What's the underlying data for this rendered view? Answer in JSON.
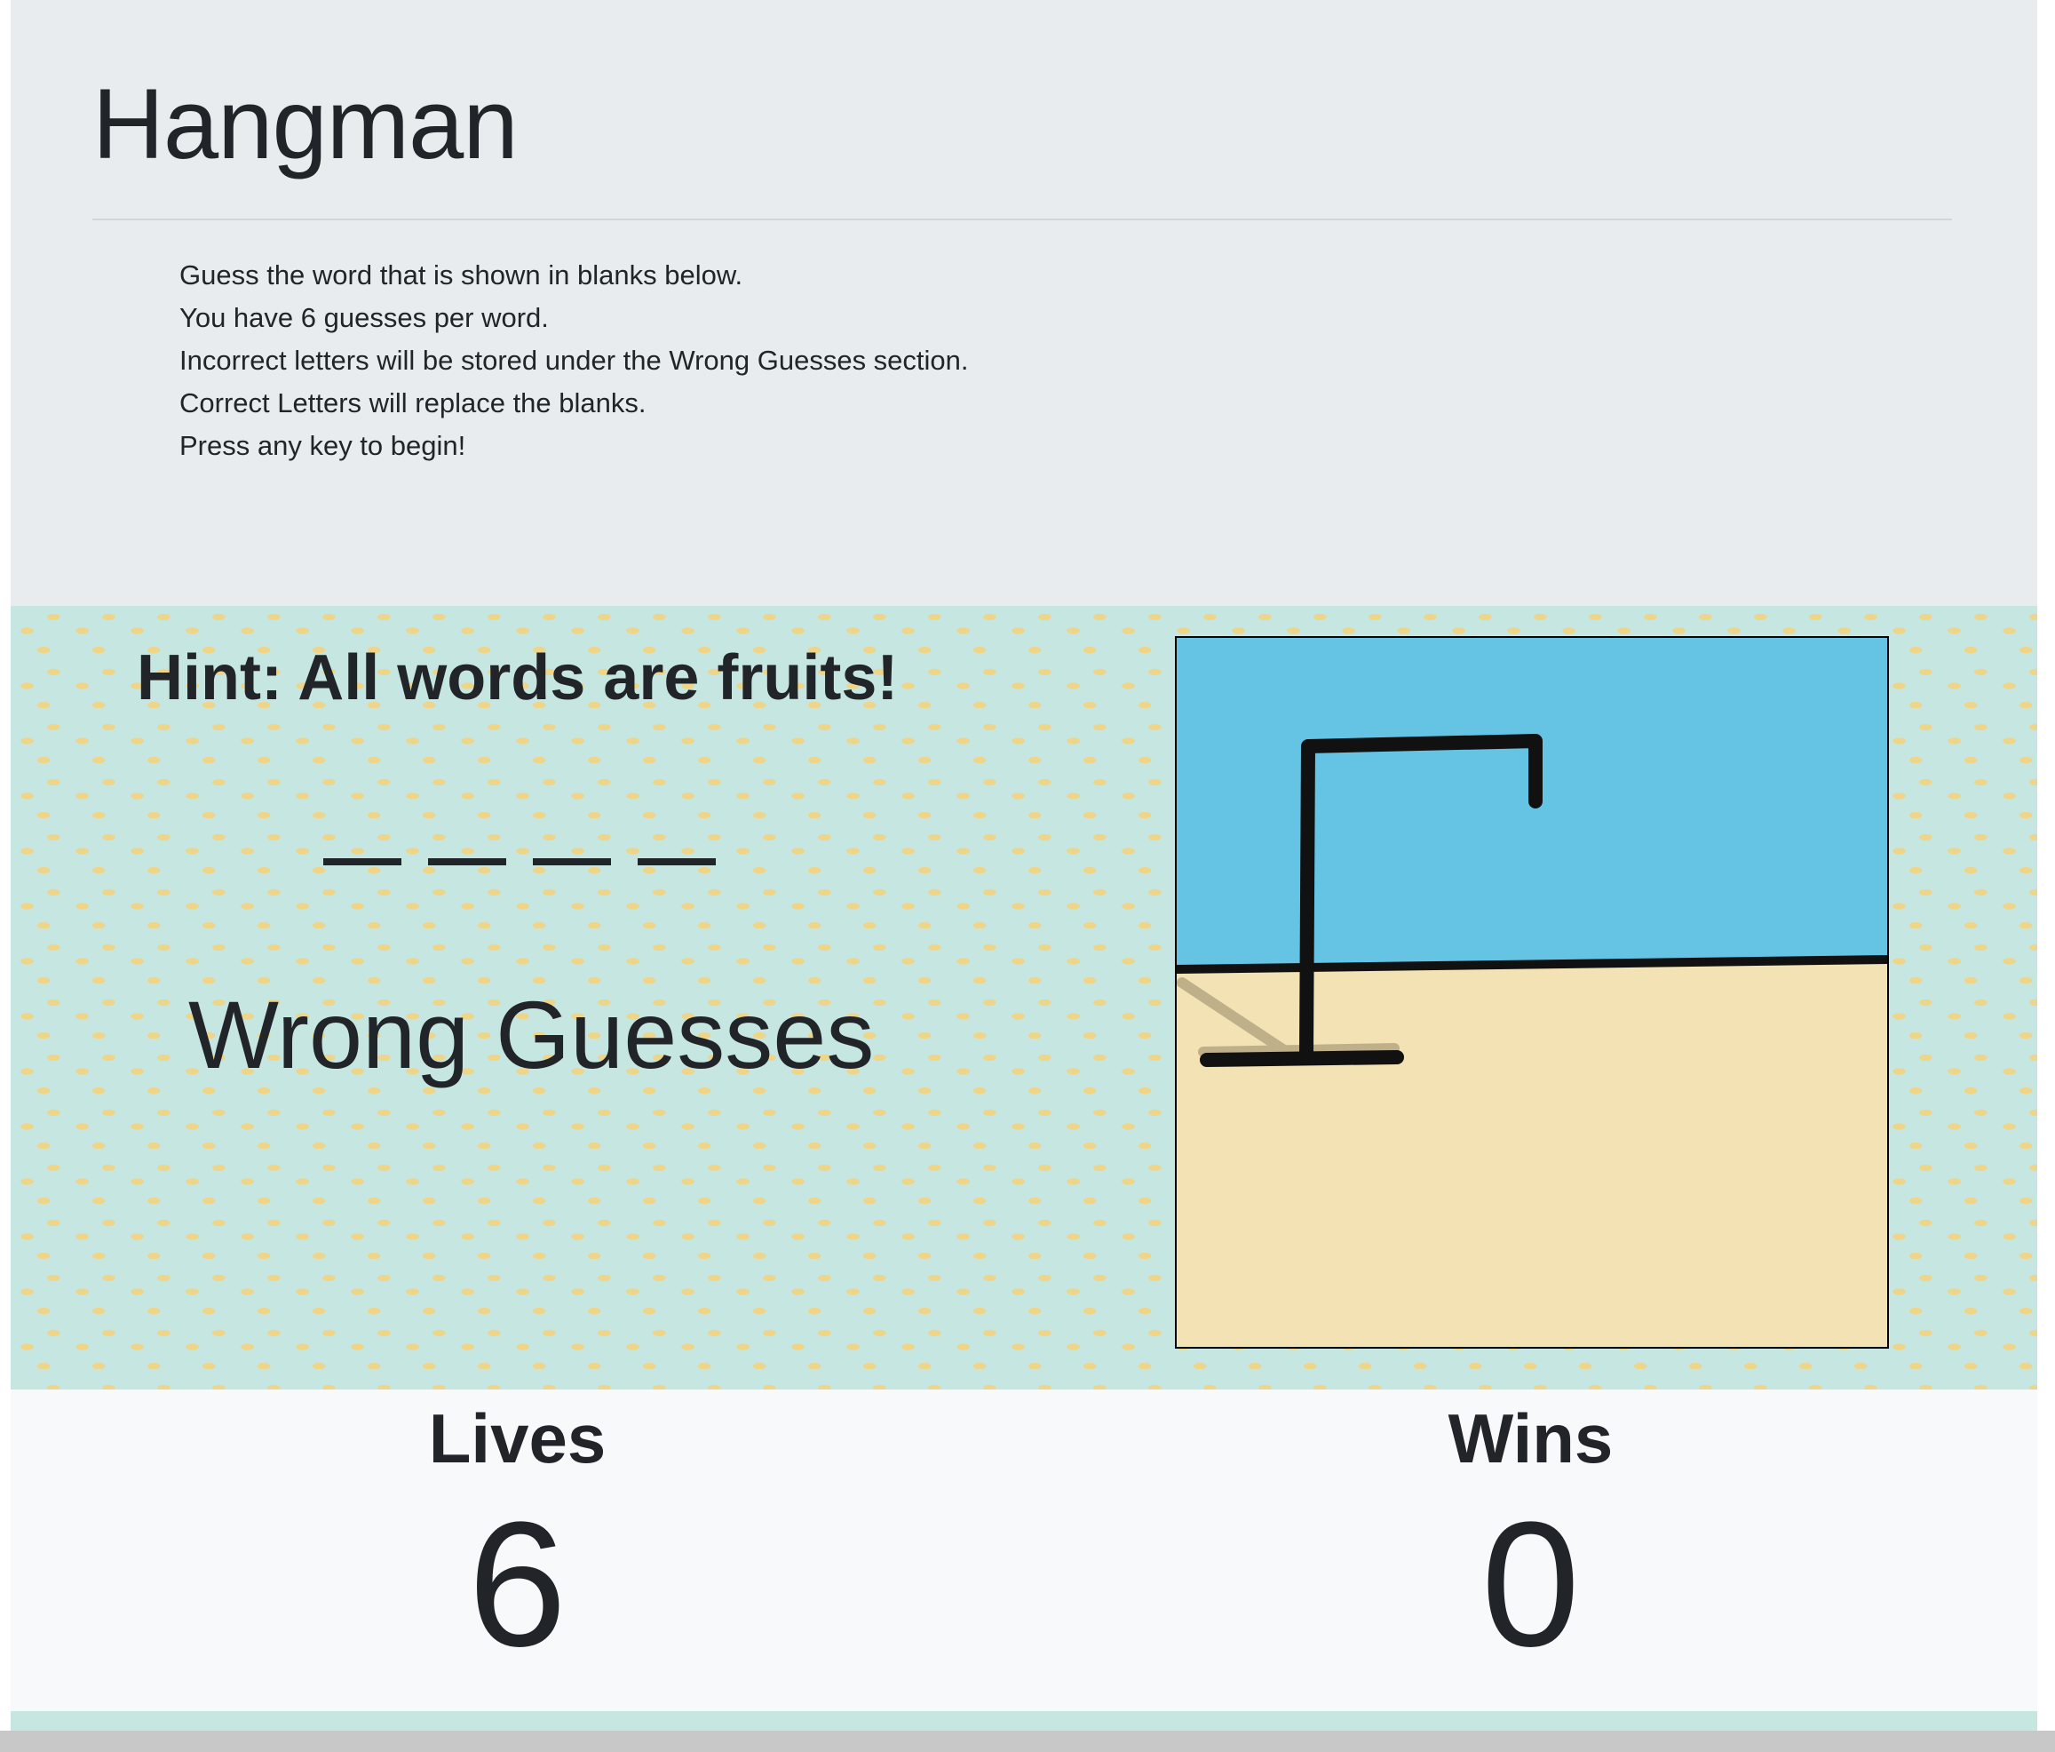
{
  "header": {
    "title": "Hangman",
    "instructions": [
      "Guess the word that is shown in blanks below.",
      "You have 6 guesses per word.",
      "Incorrect letters will be stored under the Wrong Guesses section.",
      "Correct Letters will replace the blanks.",
      "Press any key to begin!"
    ]
  },
  "game": {
    "hint": "Hint: All words are fruits!",
    "blanks_count": 4,
    "wrong_guesses_title": "Wrong Guesses",
    "wrong_guesses": ""
  },
  "scoreboard": {
    "lives_label": "Lives",
    "lives_value": "6",
    "wins_label": "Wins",
    "wins_value": "0"
  },
  "colors": {
    "sky": "#65c4e3",
    "ground": "#f3e3b4",
    "pattern_bg": "#c6e6e2",
    "header_bg": "#e9ecef",
    "score_bg": "#f8f9fa"
  }
}
